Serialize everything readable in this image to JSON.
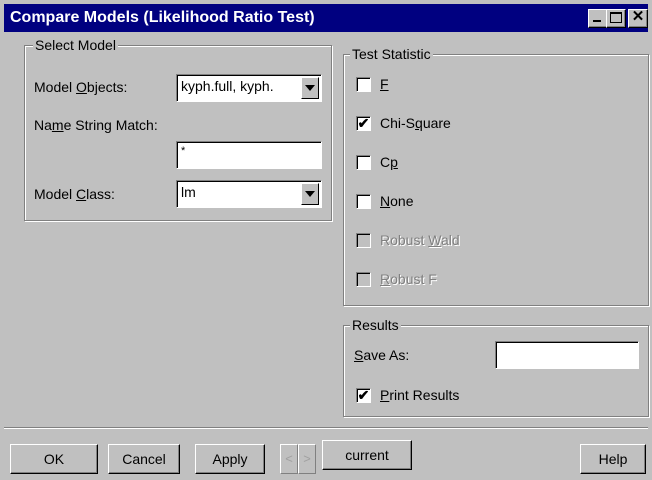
{
  "window": {
    "title": "Compare Models (Likelihood Ratio Test)"
  },
  "select_model": {
    "legend": "Select Model",
    "model_objects_label_pre": "Model ",
    "model_objects_label_ul": "O",
    "model_objects_label_post": "bjects:",
    "model_objects_value": "kyph.full, kyph.",
    "name_string_label_pre": "Na",
    "name_string_label_ul": "m",
    "name_string_label_post": "e String Match:",
    "name_string_value": "*",
    "model_class_label_pre": "Model ",
    "model_class_label_ul": "C",
    "model_class_label_post": "lass:",
    "model_class_value": "lm"
  },
  "test_statistic": {
    "legend": "Test Statistic",
    "options": [
      {
        "pre": "",
        "ul": "F",
        "post": "",
        "checked": false,
        "enabled": true
      },
      {
        "pre": "Chi-S",
        "ul": "q",
        "post": "uare",
        "checked": true,
        "enabled": true
      },
      {
        "pre": "C",
        "ul": "p",
        "post": "",
        "checked": false,
        "enabled": true
      },
      {
        "pre": "",
        "ul": "N",
        "post": "one",
        "checked": false,
        "enabled": true
      },
      {
        "pre": "Robust ",
        "ul": "W",
        "post": "ald",
        "checked": false,
        "enabled": false
      },
      {
        "pre": "",
        "ul": "R",
        "post": "obust F",
        "checked": false,
        "enabled": false
      }
    ]
  },
  "results": {
    "legend": "Results",
    "save_as_label_pre": "",
    "save_as_label_ul": "S",
    "save_as_label_post": "ave As:",
    "save_as_value": "",
    "print_results_pre": "",
    "print_results_ul": "P",
    "print_results_post": "rint Results",
    "print_results_checked": true
  },
  "buttons": {
    "ok": "OK",
    "cancel": "Cancel",
    "apply": "Apply",
    "prev": "<",
    "next": ">",
    "current": "current",
    "help": "Help"
  },
  "check_mark": "✔",
  "icons": {
    "minimize": "minimize-icon",
    "maximize": "maximize-icon",
    "close": "close-icon",
    "dropdown": "chevron-down-icon"
  }
}
